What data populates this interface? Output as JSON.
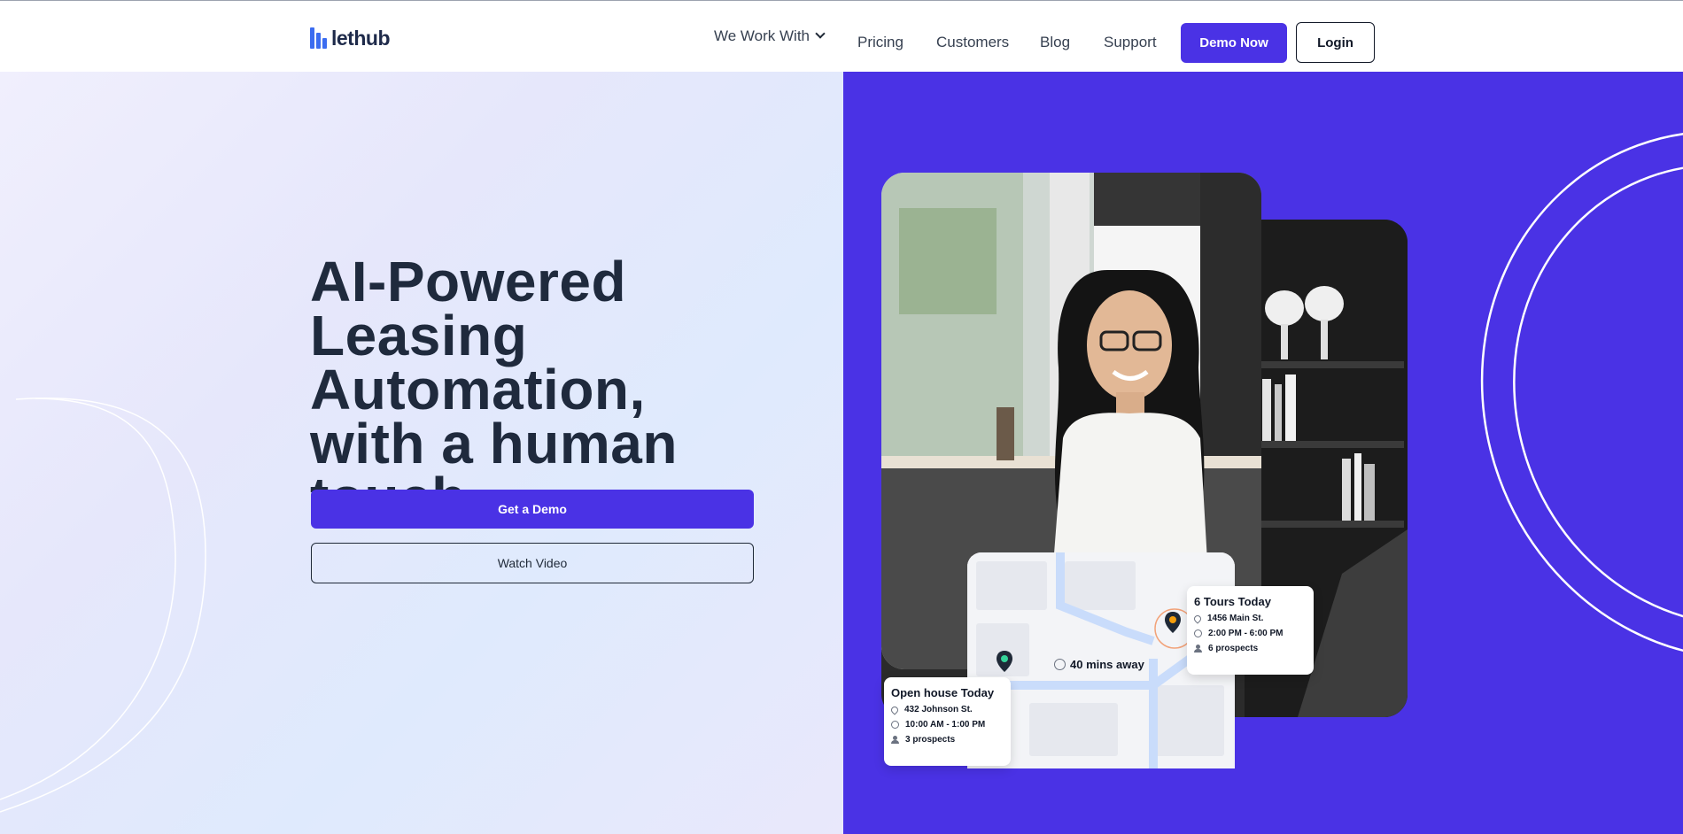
{
  "brand": {
    "logo_text": "lethub",
    "accent": "#4a32e5",
    "logo_color": "#3b6cf0"
  },
  "nav": {
    "items": [
      {
        "label": "We Work With",
        "has_dropdown": true
      },
      {
        "label": "Pricing"
      },
      {
        "label": "Customers"
      },
      {
        "label": "Blog"
      },
      {
        "label": "Support"
      }
    ],
    "demo_label": "Demo Now",
    "login_label": "Login"
  },
  "hero": {
    "title_lines": [
      "AI-Powered",
      "Leasing",
      "Automation,",
      "with a human",
      "touch."
    ],
    "primary_cta": "Get a Demo",
    "secondary_cta": "Watch Video"
  },
  "map": {
    "distance_label": "40 mins away",
    "open_house": {
      "title": "Open house Today",
      "address": "432 Johnson St.",
      "time": "10:00 AM - 1:00 PM",
      "prospects": "3 prospects"
    },
    "tours": {
      "title": "6 Tours Today",
      "address": "1456 Main St.",
      "time": "2:00 PM - 6:00 PM",
      "prospects": "6 prospects"
    }
  }
}
